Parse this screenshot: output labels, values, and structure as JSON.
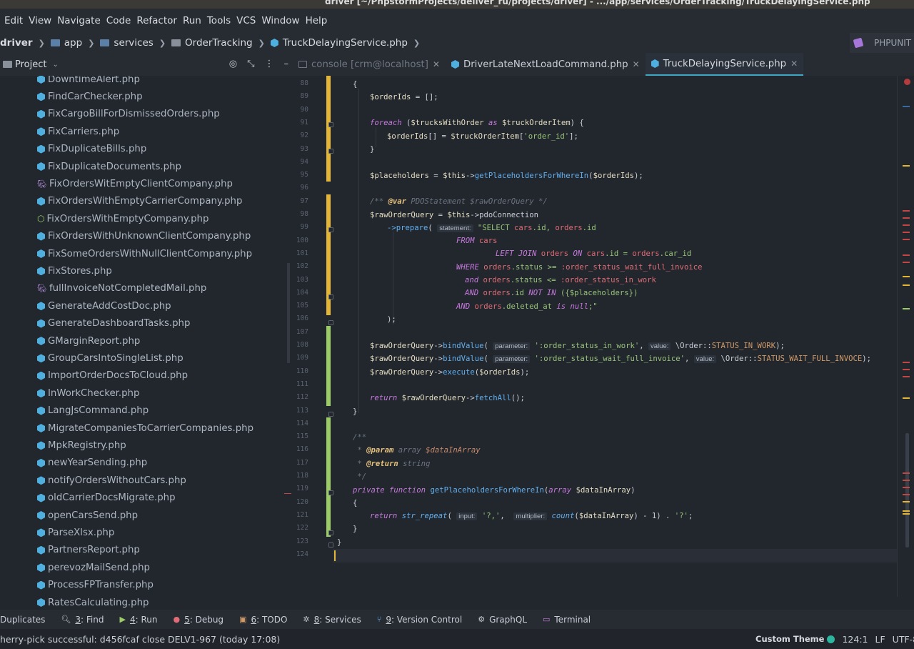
{
  "window_title": "driver [~/PhpstormProjects/deliver_ru/projects/driver] - .../app/services/OrderTracking/TruckDelayingService.php",
  "menu": [
    "Edit",
    "View",
    "Navigate",
    "Code",
    "Refactor",
    "Run",
    "Tools",
    "VCS",
    "Window",
    "Help"
  ],
  "breadcrumbs": [
    "driver",
    "app",
    "services",
    "OrderTracking",
    "TruckDelayingService.php"
  ],
  "run_config": "PHPUNIT",
  "project_panel": {
    "title": "Project"
  },
  "files": [
    {
      "name": "DowntimeAlert.php",
      "icon": "php-class-icon"
    },
    {
      "name": "FindCarChecker.php",
      "icon": "php-class-icon"
    },
    {
      "name": "FixCargoBillForDismissedOrders.php",
      "icon": "php-class-icon"
    },
    {
      "name": "FixCarriers.php",
      "icon": "php-class-icon"
    },
    {
      "name": "FixDuplicateBills.php",
      "icon": "php-class-icon"
    },
    {
      "name": "FixDuplicateDocuments.php",
      "icon": "php-class-icon"
    },
    {
      "name": "FixOrdersWitEmptyClientCompany.php",
      "icon": "php-elephant-icon"
    },
    {
      "name": "FixOrdersWithEmptyCarrierCompany.php",
      "icon": "php-class-icon"
    },
    {
      "name": "FixOrdersWithEmptyCompany.php",
      "icon": "php-trait-icon"
    },
    {
      "name": "FixOrdersWithUnknownClientCompany.php",
      "icon": "php-class-icon"
    },
    {
      "name": "FixSomeOrdersWithNullClientCompany.php",
      "icon": "php-class-icon"
    },
    {
      "name": "FixStores.php",
      "icon": "php-class-icon"
    },
    {
      "name": "fullInvoiceNotCompletedMail.php",
      "icon": "php-elephant-icon"
    },
    {
      "name": "GenerateAddCostDoc.php",
      "icon": "php-class-icon"
    },
    {
      "name": "GenerateDashboardTasks.php",
      "icon": "php-class-icon"
    },
    {
      "name": "GMarginReport.php",
      "icon": "php-class-icon"
    },
    {
      "name": "GroupCarsIntoSingleList.php",
      "icon": "php-class-icon"
    },
    {
      "name": "ImportOrderDocsToCloud.php",
      "icon": "php-class-icon"
    },
    {
      "name": "InWorkChecker.php",
      "icon": "php-class-icon"
    },
    {
      "name": "LangJsCommand.php",
      "icon": "php-class-icon"
    },
    {
      "name": "MigrateCompaniesToCarrierCompanies.php",
      "icon": "php-class-icon"
    },
    {
      "name": "MpkRegistry.php",
      "icon": "php-class-icon"
    },
    {
      "name": "newYearSending.php",
      "icon": "php-class-icon"
    },
    {
      "name": "notifyOrdersWithoutCars.php",
      "icon": "php-class-icon"
    },
    {
      "name": "oldCarrierDocsMigrate.php",
      "icon": "php-class-icon"
    },
    {
      "name": "openCarsSend.php",
      "icon": "php-class-icon"
    },
    {
      "name": "ParseXlsx.php",
      "icon": "php-class-icon"
    },
    {
      "name": "PartnersReport.php",
      "icon": "php-class-icon"
    },
    {
      "name": "perevozMailSend.php",
      "icon": "php-class-icon"
    },
    {
      "name": "ProcessFPTransfer.php",
      "icon": "php-class-icon"
    },
    {
      "name": "RatesCalculating.php",
      "icon": "php-class-icon"
    }
  ],
  "tabs": [
    {
      "label": "console [crm@localhost]",
      "kind": "console"
    },
    {
      "label": "DriverLateNextLoadCommand.php",
      "kind": "php"
    },
    {
      "label": "TruckDelayingService.php",
      "kind": "php",
      "active": true
    }
  ],
  "line_numbers": [
    "88",
    "89",
    "90",
    "91",
    "92",
    "93",
    "94",
    "95",
    "96",
    "97",
    "98",
    "99",
    "100",
    "101",
    "102",
    "103",
    "104",
    "105",
    "106",
    "107",
    "108",
    "109",
    "110",
    "111",
    "112",
    "113",
    "114",
    "115",
    "116",
    "117",
    "118",
    "119",
    "120",
    "121",
    "122",
    "123",
    "124"
  ],
  "code": {
    "l88": "{",
    "l89_a": "$orderIds",
    "l89_b": " = [];",
    "l91_kw": "foreach",
    "l91_a": " (",
    "l91_v1": "$trucksWithOrder",
    "l91_as": " as ",
    "l91_v2": "$truckOrderItem",
    "l91_b": ") {",
    "l92_v1": "$orderIds",
    "l92_a": "[] = ",
    "l92_v2": "$truckOrderItem",
    "l92_b": "[",
    "l92_s": "'order_id'",
    "l92_c": "];",
    "l93": "}",
    "l95_v": "$placeholders",
    "l95_a": " = ",
    "l95_t": "$this",
    "l95_op": "->",
    "l95_fn": "getPlaceholdersForWhereIn",
    "l95_b": "(",
    "l95_v2": "$orderIds",
    "l95_c": ");",
    "l97_c1": "/** ",
    "l97_tag": "@var",
    "l97_c2": " PDOStatement $rawOrderQuery */",
    "l98_v": "$rawOrderQuery",
    "l98_a": " = ",
    "l98_t": "$this",
    "l98_op": "->",
    "l98_p": "pdoConnection",
    "l99_op": "->",
    "l99_fn": "prepare",
    "l99_b": "( ",
    "l99_hint": "statement:",
    "l99_s": " \"SELECT ",
    "l99_t1": "cars",
    "l99_s2": ".id, ",
    "l99_t2": "orders",
    "l99_s3": ".id",
    "l100_k": "FROM ",
    "l100_t": "cars",
    "l101_k": "LEFT JOIN ",
    "l101_t": "orders",
    "l101_k2": " ON ",
    "l101_t2": "cars",
    "l101_s": ".id = ",
    "l101_t3": "orders",
    "l101_s2": ".car_id",
    "l102_k": "WHERE ",
    "l102_t": "orders",
    "l102_s": ".status >= ",
    "l102_p": ":order_status_wait_full_invoice",
    "l103_k": "and ",
    "l103_t": "orders",
    "l103_s": ".status <= ",
    "l103_p": ":order_status_in_work",
    "l104_k": "AND ",
    "l104_t": "orders",
    "l104_s": ".id ",
    "l104_k2": "NOT IN",
    "l104_s2": " ({$placeholders})",
    "l105_k": "AND ",
    "l105_t": "orders",
    "l105_s": ".deleted_at ",
    "l105_k2": "is null",
    "l105_s2": ";\"",
    "l106": ");",
    "l108_v": "$rawOrderQuery",
    "l108_op": "->",
    "l108_fn": "bindValue",
    "l108_b": "( ",
    "l108_h1": "parameter:",
    "l108_s": " ':order_status_in_work'",
    "l108_c": ", ",
    "l108_h2": "value:",
    "l108_ns": " \\Order::",
    "l108_const": "STATUS_IN_WORK",
    "l108_e": ");",
    "l109_v": "$rawOrderQuery",
    "l109_op": "->",
    "l109_fn": "bindValue",
    "l109_b": "( ",
    "l109_h1": "parameter:",
    "l109_s": " ':order_status_wait_full_invoice'",
    "l109_c": ", ",
    "l109_h2": "value:",
    "l109_ns": " \\Order::",
    "l109_const": "STATUS_WAIT_FULL_INVOCE",
    "l109_e": ");",
    "l110_v": "$rawOrderQuery",
    "l110_op": "->",
    "l110_fn": "execute",
    "l110_b": "(",
    "l110_v2": "$orderIds",
    "l110_e": ");",
    "l112_k": "return ",
    "l112_v": "$rawOrderQuery",
    "l112_op": "->",
    "l112_fn": "fetchAll",
    "l112_e": "();",
    "l113": "}",
    "l115": "/**",
    "l116_a": " * ",
    "l116_tag": "@param",
    "l116_b": " array ",
    "l116_v": "$dataInArray",
    "l117_a": " * ",
    "l117_tag": "@return",
    "l117_b": " string",
    "l118": " */",
    "l119_k": "private function ",
    "l119_fn": "getPlaceholdersForWhereIn",
    "l119_b": "(",
    "l119_k2": "array ",
    "l119_v": "$dataInArray",
    "l119_e": ")",
    "l120": "{",
    "l121_k": "return ",
    "l121_fn": "str_repeat",
    "l121_b": "( ",
    "l121_h1": "input:",
    "l121_s": " '?,'",
    "l121_c": ",  ",
    "l121_h2": "multiplier:",
    "l121_fn2": " count",
    "l121_b2": "(",
    "l121_v": "$dataInArray",
    "l121_e": ") - 1) . ",
    "l121_s2": "'?'",
    "l121_e2": ";",
    "l122": "}",
    "l123": "}"
  },
  "bottom_tools": [
    {
      "label": "Duplicates",
      "icon": ""
    },
    {
      "num": "3",
      "label": ": Find",
      "icon": "find-icon"
    },
    {
      "num": "4",
      "label": ": Run",
      "icon": "run-icon"
    },
    {
      "num": "5",
      "label": ": Debug",
      "icon": "debug-icon"
    },
    {
      "num": "6",
      "label": ": TODO",
      "icon": "todo-icon"
    },
    {
      "num": "8",
      "label": ": Services",
      "icon": "services-icon"
    },
    {
      "num": "9",
      "label": ": Version Control",
      "icon": "vcs-icon"
    },
    {
      "label": "GraphQL",
      "icon": "graphql-icon"
    },
    {
      "label": "Terminal",
      "icon": "terminal-icon"
    }
  ],
  "status": {
    "message": "herry-pick successful: d456fcaf close DELV1-967 (today 17:08)",
    "theme": "Custom Theme",
    "position": "124:1",
    "line_sep": "LF",
    "encoding": "UTF-8",
    "indent": "4 s"
  },
  "colors": {
    "accent": "#40a8c4",
    "vcs_modified": "#e5b635",
    "vcs_added": "#9ccc65",
    "string": "#98c379",
    "keyword": "#c678dd",
    "sql_table": "#e06c75"
  }
}
